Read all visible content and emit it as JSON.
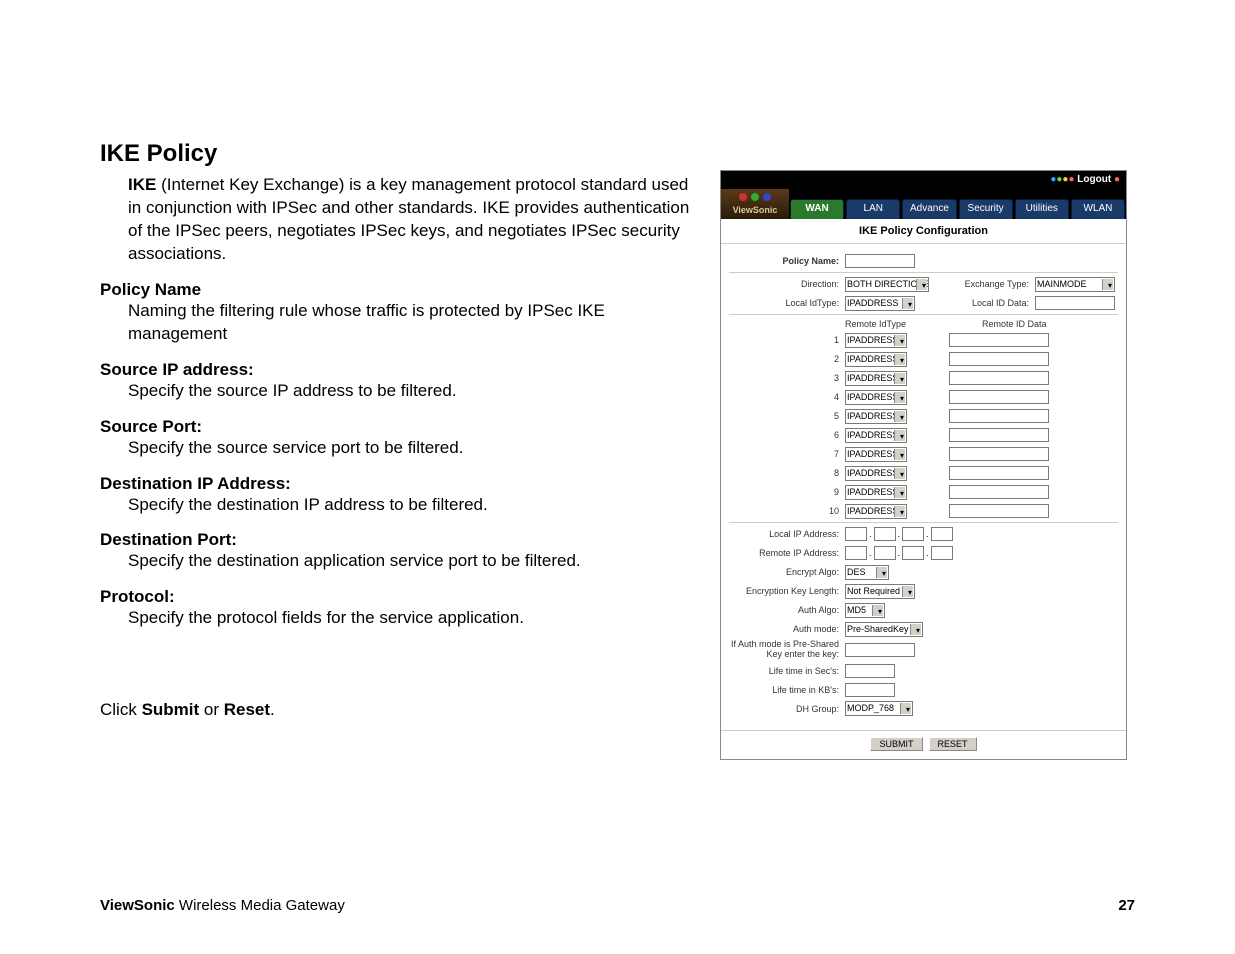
{
  "doc": {
    "heading": "IKE Policy",
    "intro": "IKE (Internet Key Exchange) is a key management protocol standard used in conjunction with IPSec and other standards. IKE provides authentication of the IPSec peers, negotiates IPSec keys, and negotiates IPSec security associations.",
    "sections": [
      {
        "title": "Policy Name",
        "body": "Naming the filtering rule whose traffic is protected by IPSec IKE management"
      },
      {
        "title": "Source IP address:",
        "body": "Specify the source IP address to be filtered."
      },
      {
        "title": "Source Port:",
        "body": "Specify the source service port to be filtered."
      },
      {
        "title": "Destination IP Address:",
        "body": "Specify the destination IP address to be filtered."
      },
      {
        "title": "Destination Port:",
        "body": "Specify the destination application service port to be filtered."
      },
      {
        "title": "Protocol:",
        "body": "Specify the protocol fields for the service application."
      }
    ],
    "click_prefix": "Click ",
    "click_submit": "Submit",
    "click_or": " or ",
    "click_reset": "Reset",
    "click_suffix": ".",
    "footer_brand": "ViewSonic",
    "footer_rest": " Wireless Media Gateway",
    "page_number": "27"
  },
  "ui": {
    "logout": "Logout",
    "brand": "ViewSonic",
    "tabs": [
      "WAN",
      "LAN",
      "Advance",
      "Security",
      "Utilities",
      "WLAN"
    ],
    "active_tab": 0,
    "panel_title": "IKE Policy Configuration",
    "policy_name_label": "Policy Name:",
    "direction_label": "Direction:",
    "direction_value": "BOTH DIRECTIONS",
    "exchange_type_label": "Exchange Type:",
    "exchange_type_value": "MAINMODE",
    "local_idtype_label": "Local IdType:",
    "local_idtype_value": "IPADDRESS",
    "local_iddata_label": "Local ID Data:",
    "remote_idtype_header": "Remote IdType",
    "remote_iddata_header": "Remote ID Data",
    "remote_rows": [
      "1",
      "2",
      "3",
      "4",
      "5",
      "6",
      "7",
      "8",
      "9",
      "10"
    ],
    "remote_select_value": "IPADDRESS",
    "local_ip_label": "Local IP Address:",
    "remote_ip_label": "Remote IP Address:",
    "encrypt_algo_label": "Encrypt Algo:",
    "encrypt_algo_value": "DES",
    "enc_key_len_label": "Encryption Key Length:",
    "enc_key_len_value": "Not Required",
    "auth_algo_label": "Auth Algo:",
    "auth_algo_value": "MD5",
    "auth_mode_label": "Auth mode:",
    "auth_mode_value": "Pre-SharedKey",
    "psk_label": "If Auth mode is Pre-Shared Key enter the key:",
    "life_secs_label": "Life time in Sec's:",
    "life_kbs_label": "Life time in KB's:",
    "dh_group_label": "DH Group:",
    "dh_group_value": "MODP_768",
    "submit_btn": "SUBMIT",
    "reset_btn": "RESET"
  }
}
